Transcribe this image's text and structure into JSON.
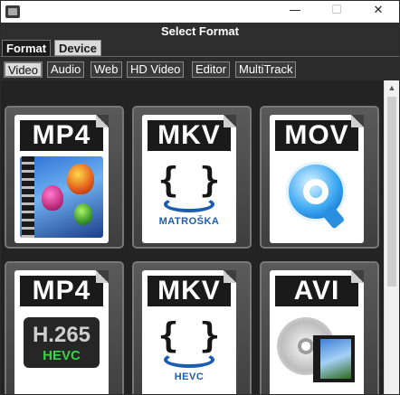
{
  "window": {
    "minimize_glyph": "—",
    "maximize_glyph": "☐",
    "close_glyph": "✕"
  },
  "header": {
    "title": "Select Format"
  },
  "primary_tabs": [
    {
      "label": "Format",
      "active": true
    },
    {
      "label": "Device",
      "active": false
    }
  ],
  "category_tabs": [
    {
      "label": "Video",
      "active": true
    },
    {
      "label": "Audio",
      "active": false
    },
    {
      "label": "Web",
      "active": false
    },
    {
      "label": "HD Video",
      "active": false
    },
    {
      "label": "Editor",
      "active": false
    },
    {
      "label": "MultiTrack",
      "active": false
    }
  ],
  "formats": [
    {
      "label": "MP4",
      "icon": "film-balloons-icon"
    },
    {
      "label": "MKV",
      "icon": "matroska-icon",
      "sub": "MATROŠKA"
    },
    {
      "label": "MOV",
      "icon": "quicktime-icon"
    },
    {
      "label": "MP4",
      "icon": "h265-hevc-icon",
      "badge_top": "H.265",
      "badge_bottom": "HEVC"
    },
    {
      "label": "MKV",
      "icon": "matroska-hevc-icon",
      "sub": "HEVC"
    },
    {
      "label": "AVI",
      "icon": "disc-film-icon"
    }
  ],
  "scrollbar": {
    "up_glyph": "▲"
  },
  "colors": {
    "window_bg": "#1f1f1f",
    "header_bg": "#2e2e2e",
    "accent_blue": "#1b5db0",
    "hevc_green": "#39d24a"
  }
}
